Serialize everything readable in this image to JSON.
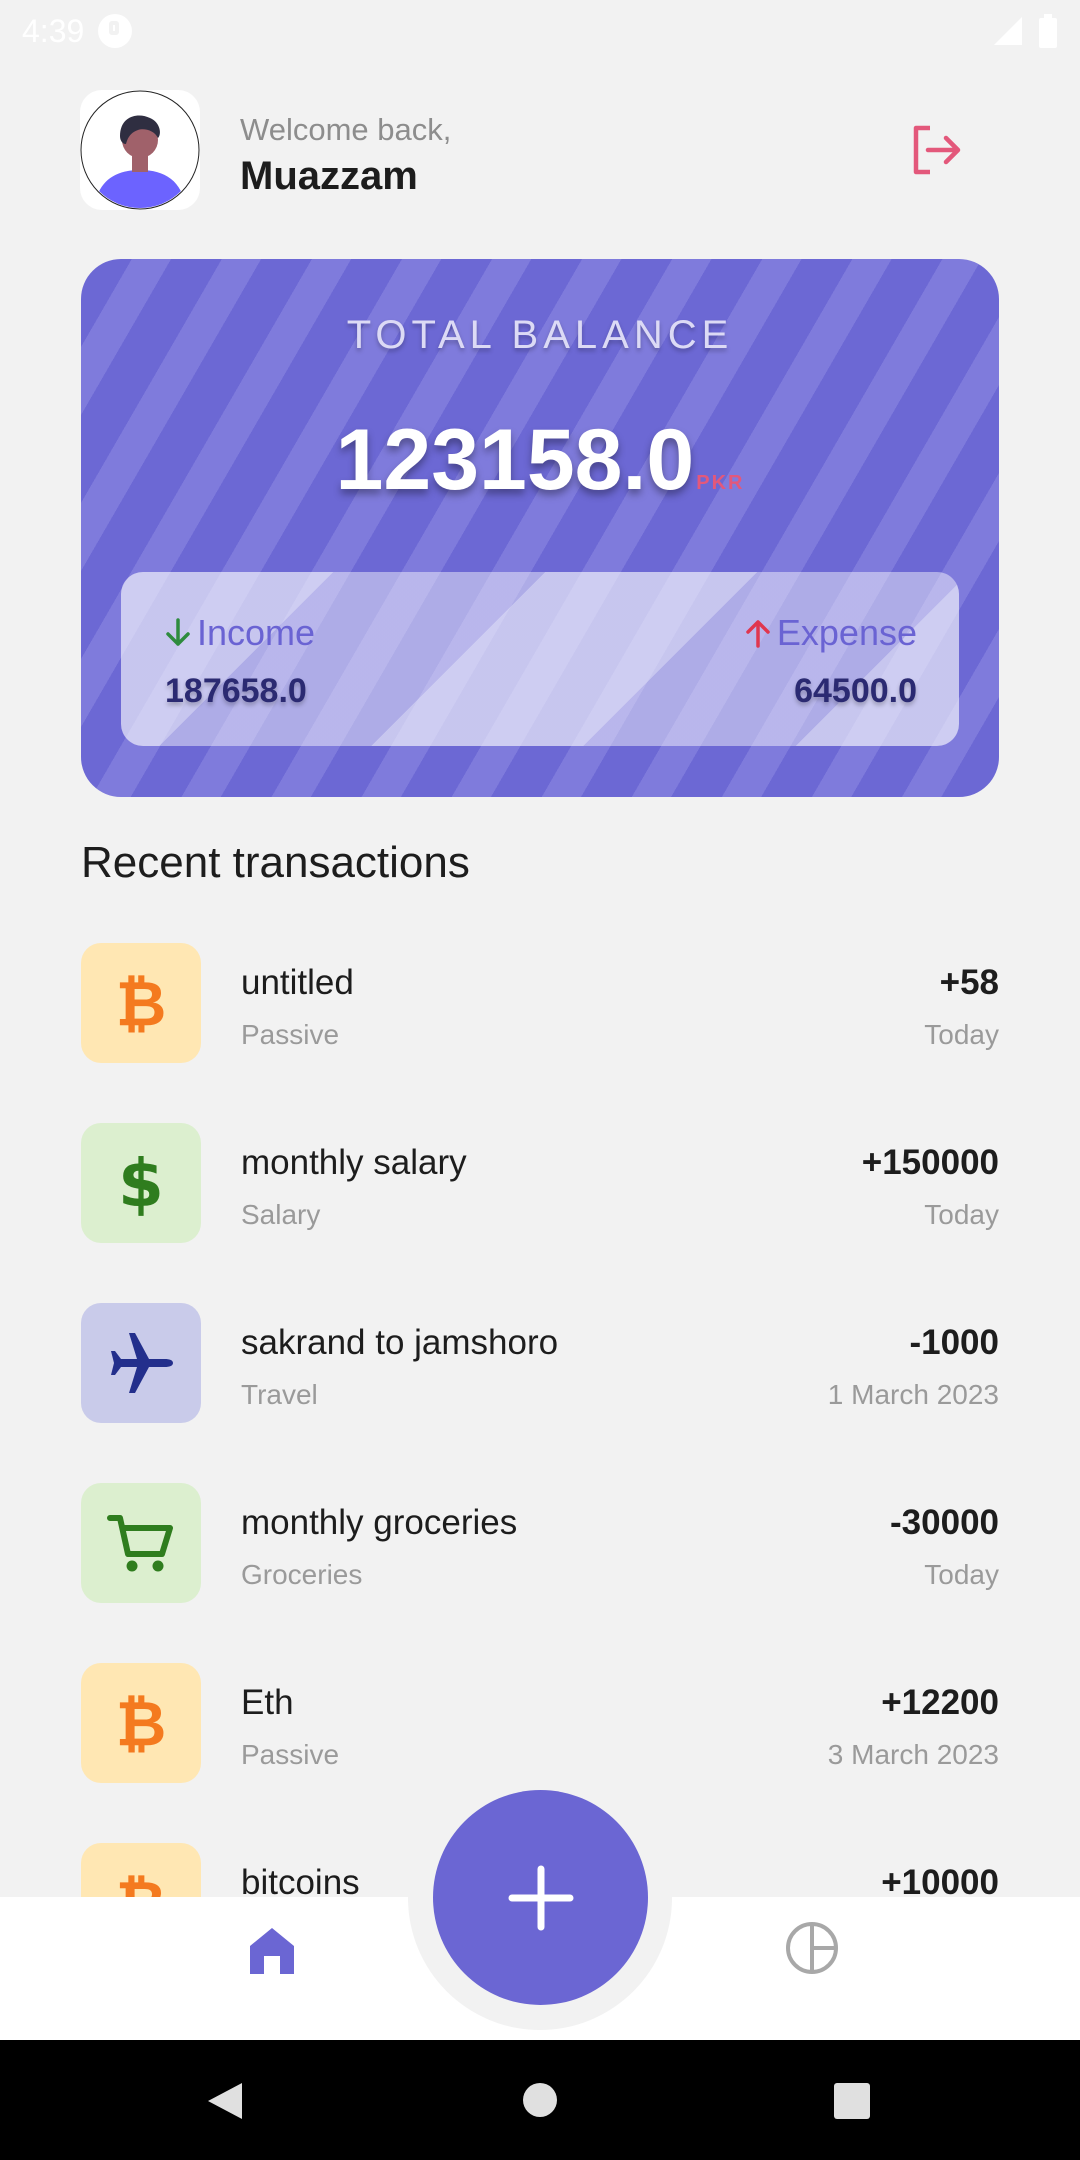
{
  "status_bar": {
    "time": "4:39"
  },
  "header": {
    "welcome": "Welcome back,",
    "username": "Muazzam"
  },
  "balance": {
    "title": "TOTAL BALANCE",
    "amount": "123158.0",
    "currency": "PKR",
    "income_label": "Income",
    "income_value": "187658.0",
    "expense_label": "Expense",
    "expense_value": "64500.0"
  },
  "section_title": "Recent transactions",
  "transactions": [
    {
      "title": "untitled",
      "category": "Passive",
      "amount": "+58",
      "date": "Today",
      "icon": "bitcoin-icon"
    },
    {
      "title": "monthly salary",
      "category": "Salary",
      "amount": "+150000",
      "date": "Today",
      "icon": "dollar-icon"
    },
    {
      "title": "sakrand to jamshoro",
      "category": "Travel",
      "amount": "-1000",
      "date": "1 March 2023",
      "icon": "airplane-icon"
    },
    {
      "title": "monthly groceries",
      "category": "Groceries",
      "amount": "-30000",
      "date": "Today",
      "icon": "cart-icon"
    },
    {
      "title": "Eth",
      "category": "Passive",
      "amount": "+12200",
      "date": "3 March 2023",
      "icon": "bitcoin-icon"
    },
    {
      "title": "bitcoins",
      "category": "",
      "amount": "+10000",
      "date": "",
      "icon": "bitcoin-icon"
    }
  ],
  "colors": {
    "accent": "#6b66d3",
    "logout": "#e3587b",
    "income_arrow": "#2e8b3e",
    "expense_arrow": "#e0364f"
  }
}
